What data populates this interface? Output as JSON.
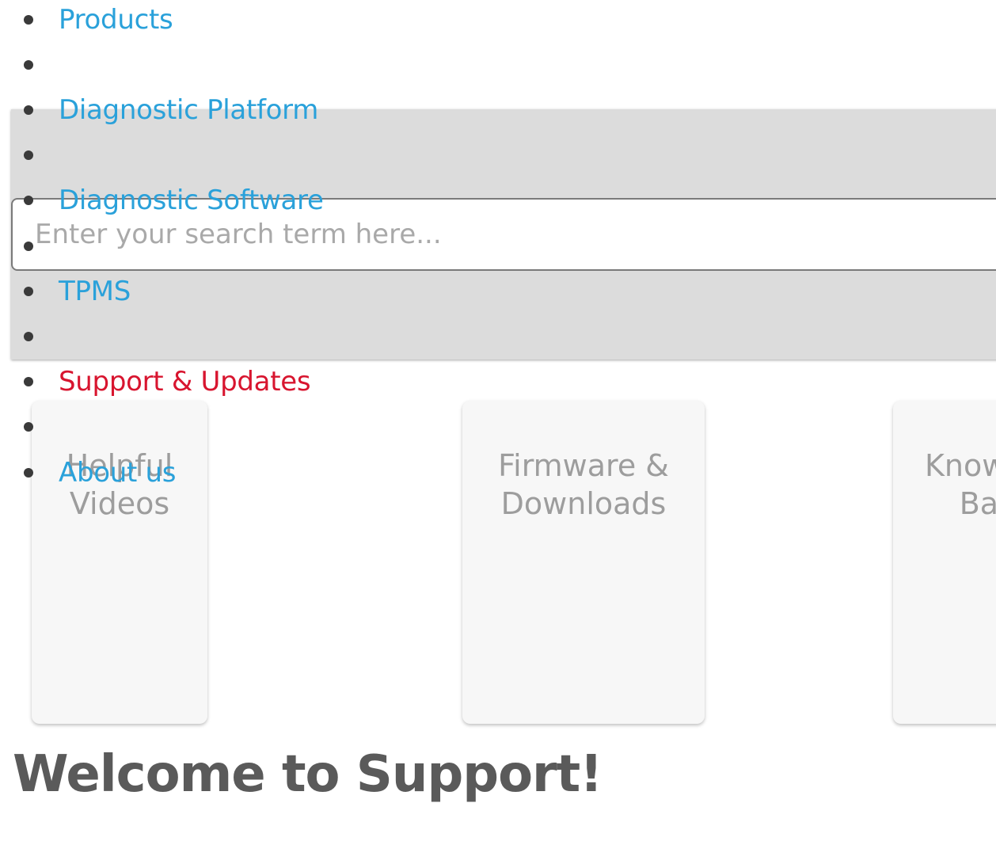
{
  "nav": {
    "items": [
      {
        "label": "Products",
        "active": false
      },
      {
        "label": "",
        "active": false
      },
      {
        "label": "Diagnostic Platform",
        "active": false
      },
      {
        "label": "",
        "active": false
      },
      {
        "label": "Diagnostic Software",
        "active": false
      },
      {
        "label": "",
        "active": false
      },
      {
        "label": "TPMS",
        "active": false
      },
      {
        "label": "",
        "active": false
      },
      {
        "label": "Support & Updates",
        "active": true
      },
      {
        "label": "",
        "active": false
      },
      {
        "label": "About us",
        "active": false
      }
    ]
  },
  "search": {
    "placeholder": "Enter your search term here...",
    "value": ""
  },
  "cards": [
    {
      "label": "Helpful Videos"
    },
    {
      "label": "Firmware & Downloads"
    },
    {
      "label": "Knowledge Base"
    }
  ],
  "heading": "Welcome to Support!",
  "colors": {
    "link": "#2aa1da",
    "active_link": "#d8152f",
    "heading": "#5a5a5a",
    "card_text": "#9d9d9d",
    "band": "#dcdcdc"
  }
}
